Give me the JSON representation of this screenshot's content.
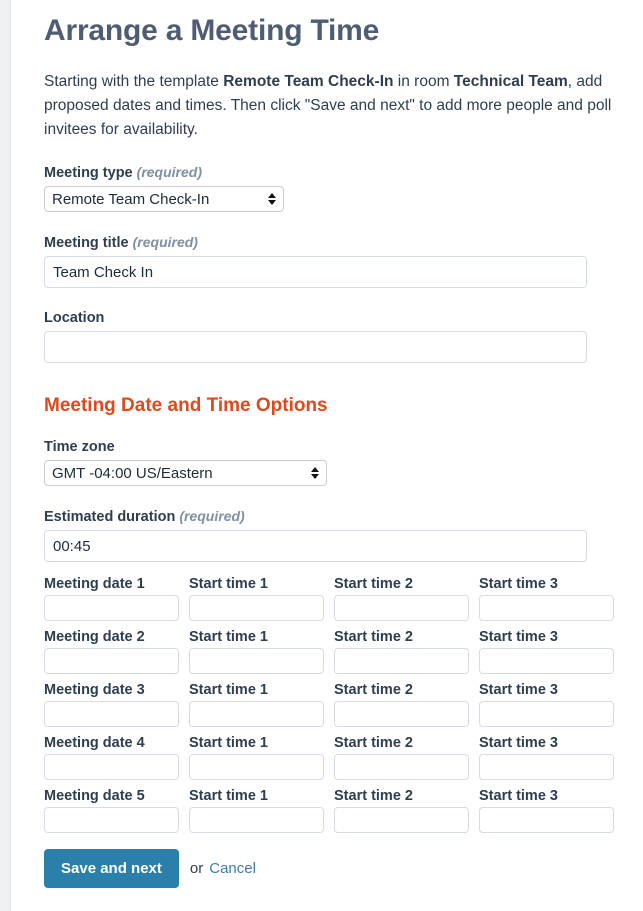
{
  "page": {
    "title": "Arrange a Meeting Time",
    "intro": {
      "part1": "Starting with the template ",
      "template_name": "Remote Team Check-In",
      "part2": " in room ",
      "room_name": "Technical Team",
      "part3": ", add proposed dates and times. Then click \"Save and next\" to add more people and poll invitees for availability."
    }
  },
  "form": {
    "meeting_type": {
      "label": "Meeting type",
      "required_text": "(required)",
      "value": "Remote Team Check-In"
    },
    "meeting_title": {
      "label": "Meeting title",
      "required_text": "(required)",
      "value": "Team Check In",
      "placeholder": ""
    },
    "location": {
      "label": "Location",
      "value": "",
      "placeholder": ""
    },
    "section_heading": "Meeting Date and Time Options",
    "time_zone": {
      "label": "Time zone",
      "value": "GMT -04:00 US/Eastern"
    },
    "estimated_duration": {
      "label": "Estimated duration",
      "required_text": "(required)",
      "value": "00:45",
      "placeholder": ""
    },
    "date_rows": [
      {
        "date_label": "Meeting date 1",
        "date_value": "",
        "times": [
          {
            "label": "Start time 1",
            "value": ""
          },
          {
            "label": "Start time 2",
            "value": ""
          },
          {
            "label": "Start time 3",
            "value": ""
          }
        ]
      },
      {
        "date_label": "Meeting date 2",
        "date_value": "",
        "times": [
          {
            "label": "Start time 1",
            "value": ""
          },
          {
            "label": "Start time 2",
            "value": ""
          },
          {
            "label": "Start time 3",
            "value": ""
          }
        ]
      },
      {
        "date_label": "Meeting date 3",
        "date_value": "",
        "times": [
          {
            "label": "Start time 1",
            "value": ""
          },
          {
            "label": "Start time 2",
            "value": ""
          },
          {
            "label": "Start time 3",
            "value": ""
          }
        ]
      },
      {
        "date_label": "Meeting date 4",
        "date_value": "",
        "times": [
          {
            "label": "Start time 1",
            "value": ""
          },
          {
            "label": "Start time 2",
            "value": ""
          },
          {
            "label": "Start time 3",
            "value": ""
          }
        ]
      },
      {
        "date_label": "Meeting date 5",
        "date_value": "",
        "times": [
          {
            "label": "Start time 1",
            "value": ""
          },
          {
            "label": "Start time 2",
            "value": ""
          },
          {
            "label": "Start time 3",
            "value": ""
          }
        ]
      }
    ],
    "actions": {
      "submit_label": "Save and next",
      "or_text": "or",
      "cancel_label": "Cancel"
    }
  },
  "colors": {
    "title": "#4e5d73",
    "section_heading": "#dc4a1e",
    "primary_button": "#2b7fab",
    "link": "#3f7ca8",
    "required_hint": "#7f8fa4",
    "gutter": "#eff0f4",
    "input_border": "#d6dce4"
  }
}
